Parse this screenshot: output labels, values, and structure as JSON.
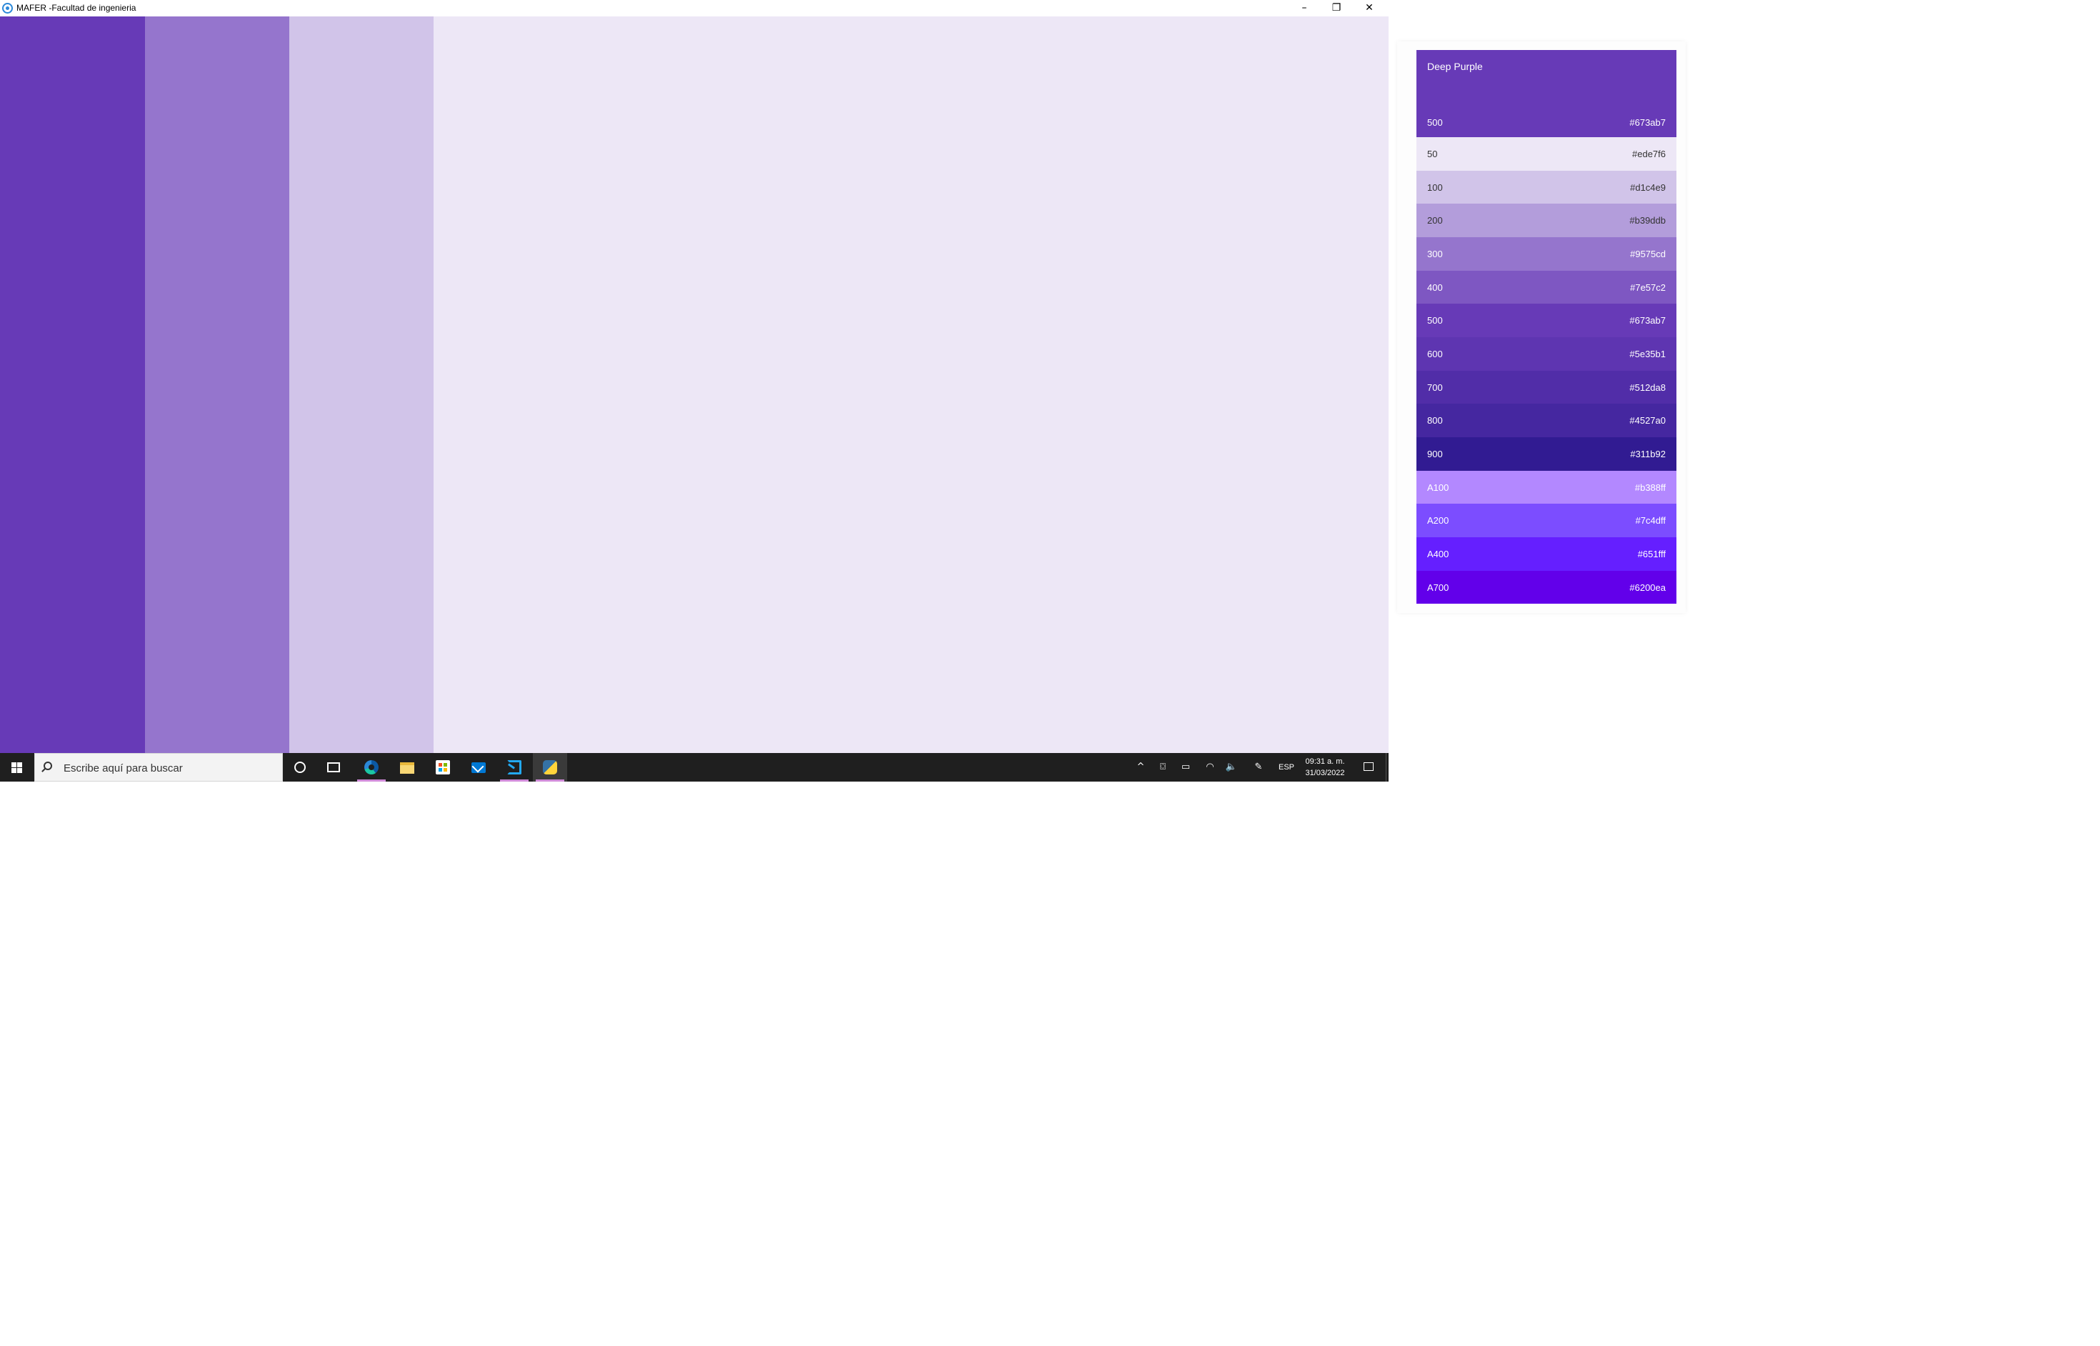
{
  "window": {
    "title": "MAFER -Facultad de ingenieria",
    "controls": {
      "minimize": "–",
      "maximize": "❐",
      "close": "✕"
    },
    "stripe_colors": [
      "#673ab7",
      "#9575cd",
      "#d1c4e9"
    ],
    "background_color": "#ede7f6"
  },
  "taskbar": {
    "search_placeholder": "Escribe aquí para buscar",
    "apps": [
      "start-icon",
      "cortana-icon",
      "task-view-icon",
      "edge-icon",
      "file-explorer-icon",
      "store-icon",
      "mail-icon",
      "vscode-icon",
      "python-icon"
    ],
    "tray": {
      "chevron": "^",
      "meet": "⌼",
      "battery": "▭",
      "wifi": "◠",
      "volume": "🔈",
      "pen": "✎",
      "language": "ESP",
      "time": "09:31 a. m.",
      "date": "31/03/2022"
    }
  },
  "palette": {
    "name": "Deep Purple",
    "primary": {
      "weight": "500",
      "hex": "#673ab7"
    },
    "swatches": [
      {
        "weight": "50",
        "hex": "#ede7f6",
        "text_color": "#333333"
      },
      {
        "weight": "100",
        "hex": "#d1c4e9",
        "text_color": "#333333"
      },
      {
        "weight": "200",
        "hex": "#b39ddb",
        "text_color": "#333333"
      },
      {
        "weight": "300",
        "hex": "#9575cd",
        "text_color": "#ffffff"
      },
      {
        "weight": "400",
        "hex": "#7e57c2",
        "text_color": "#ffffff"
      },
      {
        "weight": "500",
        "hex": "#673ab7",
        "text_color": "#ffffff"
      },
      {
        "weight": "600",
        "hex": "#5e35b1",
        "text_color": "#ffffff"
      },
      {
        "weight": "700",
        "hex": "#512da8",
        "text_color": "#ffffff"
      },
      {
        "weight": "800",
        "hex": "#4527a0",
        "text_color": "#ffffff"
      },
      {
        "weight": "900",
        "hex": "#311b92",
        "text_color": "#ffffff"
      },
      {
        "weight": "A100",
        "hex": "#b388ff",
        "text_color": "#ffffff"
      },
      {
        "weight": "A200",
        "hex": "#7c4dff",
        "text_color": "#ffffff"
      },
      {
        "weight": "A400",
        "hex": "#651fff",
        "text_color": "#ffffff"
      },
      {
        "weight": "A700",
        "hex": "#6200ea",
        "text_color": "#ffffff"
      }
    ]
  }
}
